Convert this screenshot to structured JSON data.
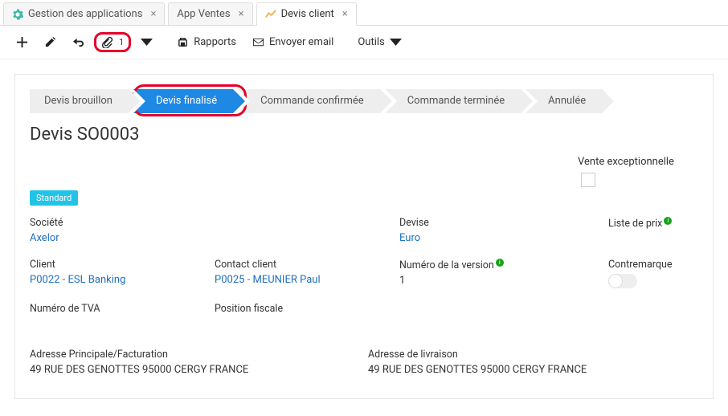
{
  "tabs": [
    {
      "label": "Gestion des applications",
      "icon": "gear"
    },
    {
      "label": "App Ventes",
      "icon": ""
    },
    {
      "label": "Devis client",
      "icon": "chart",
      "active": true
    }
  ],
  "toolbar": {
    "attach_count": "1",
    "reports_label": "Rapports",
    "email_label": "Envoyer email",
    "tools_label": "Outils"
  },
  "steps": [
    "Devis brouillon",
    "Devis finalisé",
    "Commande confirmée",
    "Commande terminée",
    "Annulée"
  ],
  "active_step_index": 1,
  "record_title": "Devis SO0003",
  "vente_exceptionnelle_label": "Vente exceptionnelle",
  "standard_badge": "Standard",
  "fields": {
    "societe_label": "Société",
    "societe_value": "Axelor",
    "devise_label": "Devise",
    "devise_value": "Euro",
    "liste_prix_label": "Liste de prix",
    "client_label": "Client",
    "client_value": "P0022 - ESL Banking",
    "contact_label": "Contact client",
    "contact_value": "P0025 - MEUNIER Paul",
    "version_label": "Numéro de la version",
    "version_value": "1",
    "contremarque_label": "Contremarque",
    "tva_label": "Numéro de TVA",
    "position_fiscale_label": "Position fiscale"
  },
  "addresses": {
    "billing_label": "Adresse Principale/Facturation",
    "billing_value": "49 RUE DES GENOTTES 95000 CERGY FRANCE",
    "shipping_label": "Adresse de livraison",
    "shipping_value": "49 RUE DES GENOTTES 95000 CERGY FRANCE"
  }
}
